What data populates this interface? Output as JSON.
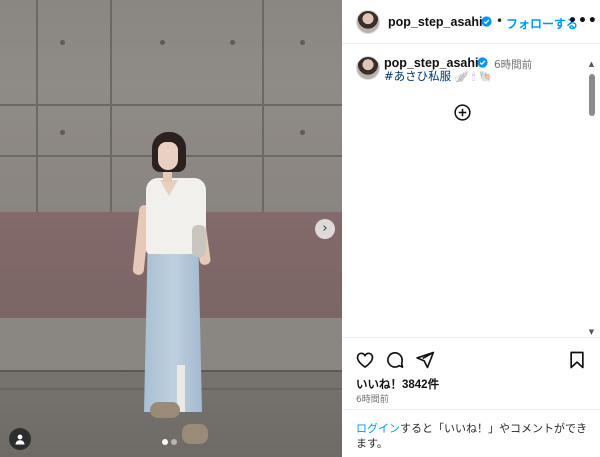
{
  "header": {
    "username": "pop_step_asahi",
    "separator": "•",
    "follow_label": "フォローする",
    "more_label": "•••"
  },
  "post": {
    "username": "pop_step_asahi",
    "time_ago": "6時間前",
    "caption_hashtag": "#あさひ私服",
    "caption_emojis": "🪽 🕯 🐚"
  },
  "engagement": {
    "likes_text": "いいね！3842件",
    "date_text": "6時間前"
  },
  "login": {
    "link_text": "ログイン",
    "rest_text": "すると「いいね！」やコメントができます。"
  },
  "carousel": {
    "next_symbol": "›",
    "slide_count": 2,
    "active_index": 0
  },
  "icons": [
    "heart-icon",
    "comment-icon",
    "share-icon",
    "bookmark-icon",
    "add-circle-icon",
    "tag-user-icon",
    "verified-badge-icon",
    "more-icon"
  ],
  "colors": {
    "accent": "#0095f6",
    "hashtag": "#00376b",
    "muted": "#737373",
    "verified": "#0095f6"
  }
}
